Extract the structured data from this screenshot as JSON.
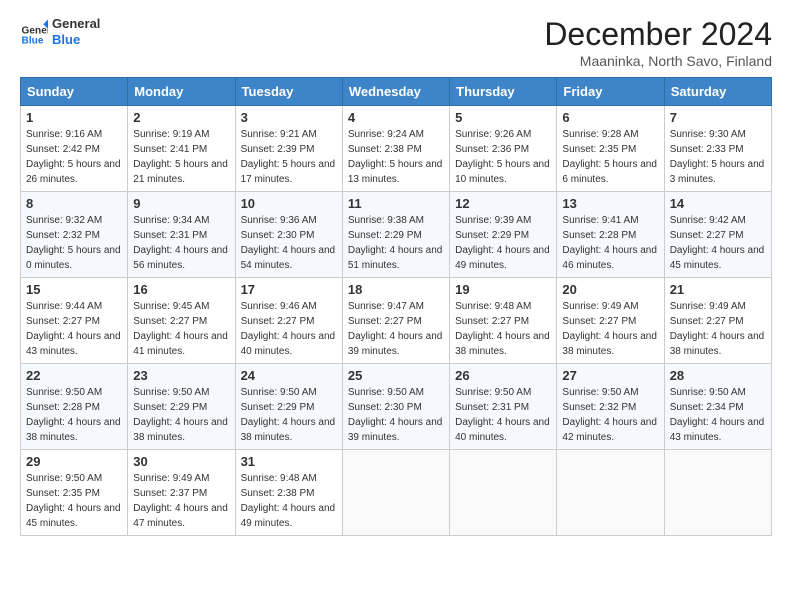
{
  "header": {
    "logo_general": "General",
    "logo_blue": "Blue",
    "month_title": "December 2024",
    "subtitle": "Maaninka, North Savo, Finland"
  },
  "days_of_week": [
    "Sunday",
    "Monday",
    "Tuesday",
    "Wednesday",
    "Thursday",
    "Friday",
    "Saturday"
  ],
  "weeks": [
    [
      {
        "day": "1",
        "sunrise": "9:16 AM",
        "sunset": "2:42 PM",
        "daylight": "5 hours and 26 minutes."
      },
      {
        "day": "2",
        "sunrise": "9:19 AM",
        "sunset": "2:41 PM",
        "daylight": "5 hours and 21 minutes."
      },
      {
        "day": "3",
        "sunrise": "9:21 AM",
        "sunset": "2:39 PM",
        "daylight": "5 hours and 17 minutes."
      },
      {
        "day": "4",
        "sunrise": "9:24 AM",
        "sunset": "2:38 PM",
        "daylight": "5 hours and 13 minutes."
      },
      {
        "day": "5",
        "sunrise": "9:26 AM",
        "sunset": "2:36 PM",
        "daylight": "5 hours and 10 minutes."
      },
      {
        "day": "6",
        "sunrise": "9:28 AM",
        "sunset": "2:35 PM",
        "daylight": "5 hours and 6 minutes."
      },
      {
        "day": "7",
        "sunrise": "9:30 AM",
        "sunset": "2:33 PM",
        "daylight": "5 hours and 3 minutes."
      }
    ],
    [
      {
        "day": "8",
        "sunrise": "9:32 AM",
        "sunset": "2:32 PM",
        "daylight": "5 hours and 0 minutes."
      },
      {
        "day": "9",
        "sunrise": "9:34 AM",
        "sunset": "2:31 PM",
        "daylight": "4 hours and 56 minutes."
      },
      {
        "day": "10",
        "sunrise": "9:36 AM",
        "sunset": "2:30 PM",
        "daylight": "4 hours and 54 minutes."
      },
      {
        "day": "11",
        "sunrise": "9:38 AM",
        "sunset": "2:29 PM",
        "daylight": "4 hours and 51 minutes."
      },
      {
        "day": "12",
        "sunrise": "9:39 AM",
        "sunset": "2:29 PM",
        "daylight": "4 hours and 49 minutes."
      },
      {
        "day": "13",
        "sunrise": "9:41 AM",
        "sunset": "2:28 PM",
        "daylight": "4 hours and 46 minutes."
      },
      {
        "day": "14",
        "sunrise": "9:42 AM",
        "sunset": "2:27 PM",
        "daylight": "4 hours and 45 minutes."
      }
    ],
    [
      {
        "day": "15",
        "sunrise": "9:44 AM",
        "sunset": "2:27 PM",
        "daylight": "4 hours and 43 minutes."
      },
      {
        "day": "16",
        "sunrise": "9:45 AM",
        "sunset": "2:27 PM",
        "daylight": "4 hours and 41 minutes."
      },
      {
        "day": "17",
        "sunrise": "9:46 AM",
        "sunset": "2:27 PM",
        "daylight": "4 hours and 40 minutes."
      },
      {
        "day": "18",
        "sunrise": "9:47 AM",
        "sunset": "2:27 PM",
        "daylight": "4 hours and 39 minutes."
      },
      {
        "day": "19",
        "sunrise": "9:48 AM",
        "sunset": "2:27 PM",
        "daylight": "4 hours and 38 minutes."
      },
      {
        "day": "20",
        "sunrise": "9:49 AM",
        "sunset": "2:27 PM",
        "daylight": "4 hours and 38 minutes."
      },
      {
        "day": "21",
        "sunrise": "9:49 AM",
        "sunset": "2:27 PM",
        "daylight": "4 hours and 38 minutes."
      }
    ],
    [
      {
        "day": "22",
        "sunrise": "9:50 AM",
        "sunset": "2:28 PM",
        "daylight": "4 hours and 38 minutes."
      },
      {
        "day": "23",
        "sunrise": "9:50 AM",
        "sunset": "2:29 PM",
        "daylight": "4 hours and 38 minutes."
      },
      {
        "day": "24",
        "sunrise": "9:50 AM",
        "sunset": "2:29 PM",
        "daylight": "4 hours and 38 minutes."
      },
      {
        "day": "25",
        "sunrise": "9:50 AM",
        "sunset": "2:30 PM",
        "daylight": "4 hours and 39 minutes."
      },
      {
        "day": "26",
        "sunrise": "9:50 AM",
        "sunset": "2:31 PM",
        "daylight": "4 hours and 40 minutes."
      },
      {
        "day": "27",
        "sunrise": "9:50 AM",
        "sunset": "2:32 PM",
        "daylight": "4 hours and 42 minutes."
      },
      {
        "day": "28",
        "sunrise": "9:50 AM",
        "sunset": "2:34 PM",
        "daylight": "4 hours and 43 minutes."
      }
    ],
    [
      {
        "day": "29",
        "sunrise": "9:50 AM",
        "sunset": "2:35 PM",
        "daylight": "4 hours and 45 minutes."
      },
      {
        "day": "30",
        "sunrise": "9:49 AM",
        "sunset": "2:37 PM",
        "daylight": "4 hours and 47 minutes."
      },
      {
        "day": "31",
        "sunrise": "9:48 AM",
        "sunset": "2:38 PM",
        "daylight": "4 hours and 49 minutes."
      },
      null,
      null,
      null,
      null
    ]
  ],
  "labels": {
    "sunrise": "Sunrise:",
    "sunset": "Sunset:",
    "daylight": "Daylight:"
  }
}
